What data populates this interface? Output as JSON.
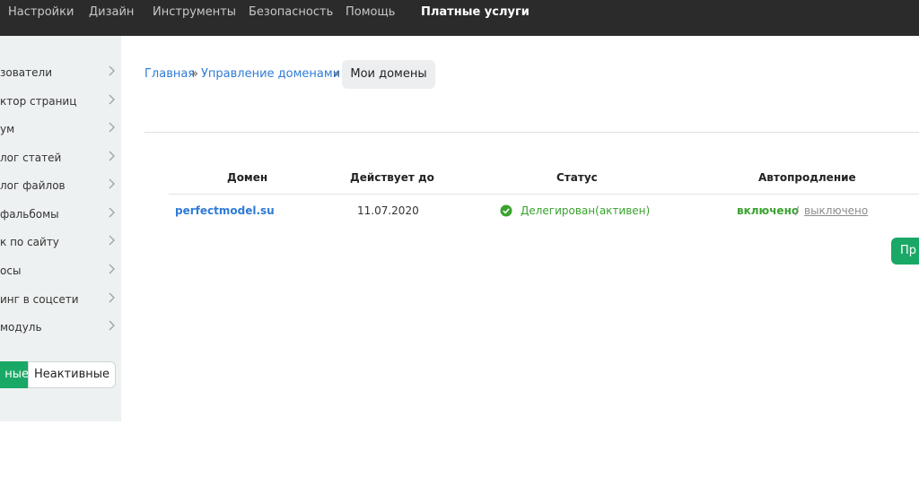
{
  "topnav": {
    "items": [
      "Настройки",
      "Дизайн",
      "Инструменты",
      "Безопасность",
      "Помощь"
    ],
    "active": "Платные услуги"
  },
  "sidebar": {
    "items": [
      {
        "label": "зователи"
      },
      {
        "label": "ктор страниц"
      },
      {
        "label": "ум"
      },
      {
        "label": "лог статей"
      },
      {
        "label": "лог файлов"
      },
      {
        "label": "фальбомы"
      },
      {
        "label": "к по сайту"
      },
      {
        "label": "осы"
      },
      {
        "label": "инг в соцсети"
      },
      {
        "label": "модуль"
      }
    ],
    "toggle": {
      "active_label": "ные",
      "inactive_label": "Неактивные"
    }
  },
  "breadcrumb": {
    "home": "Главная",
    "sep": "»",
    "section": "Управление доменами",
    "current": "Мои домены"
  },
  "table": {
    "headers": {
      "domain": "Домен",
      "valid_until": "Действует до",
      "status": "Статус",
      "autorenew": "Автопродление"
    },
    "rows": [
      {
        "domain": "perfectmodel.su",
        "valid_until": "11.07.2020",
        "status": "Делегирован(активен)",
        "autorenew_on": "включено",
        "autorenew_sep": "/",
        "autorenew_off": "выключено"
      }
    ]
  },
  "action_button": {
    "label": "Пр"
  },
  "colors": {
    "accent": "#1aa866",
    "link": "#2f7bd6",
    "status_ok": "#3aa32e",
    "topbar": "#2b2b2b",
    "sidebar_bg": "#eef1f1"
  }
}
